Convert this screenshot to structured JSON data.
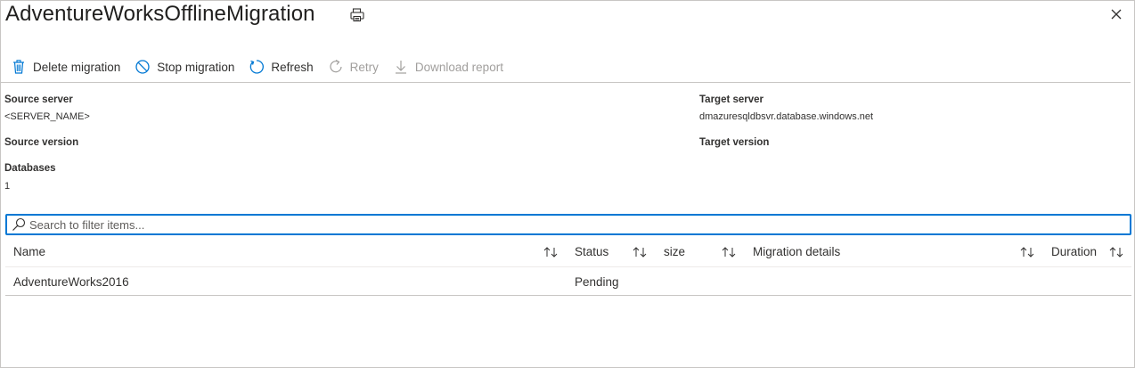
{
  "header": {
    "title": "AdventureWorksOfflineMigration"
  },
  "toolbar": {
    "delete_label": "Delete migration",
    "stop_label": "Stop migration",
    "refresh_label": "Refresh",
    "retry_label": "Retry",
    "download_label": "Download report"
  },
  "properties": {
    "source_server_label": "Source server",
    "source_server_value": "<SERVER_NAME>",
    "target_server_label": "Target server",
    "target_server_value": "dmazuresqldbsvr.database.windows.net",
    "source_version_label": "Source version",
    "target_version_label": "Target version",
    "databases_label": "Databases",
    "databases_value": "1"
  },
  "search": {
    "placeholder": "Search to filter items..."
  },
  "table": {
    "columns": [
      "Name",
      "Status",
      "size",
      "Migration details",
      "Duration"
    ],
    "rows": [
      {
        "name": "AdventureWorks2016",
        "status": "Pending",
        "size": "",
        "migration_details": "",
        "duration": ""
      }
    ]
  },
  "colors": {
    "accent": "#0078d4",
    "text": "#323130",
    "disabled": "#a19f9d",
    "border": "#c8c6c4"
  },
  "icons": [
    "print-icon",
    "close-icon",
    "trash-icon",
    "stop-icon",
    "refresh-icon",
    "retry-icon",
    "download-icon",
    "search-icon",
    "sort-icon"
  ]
}
